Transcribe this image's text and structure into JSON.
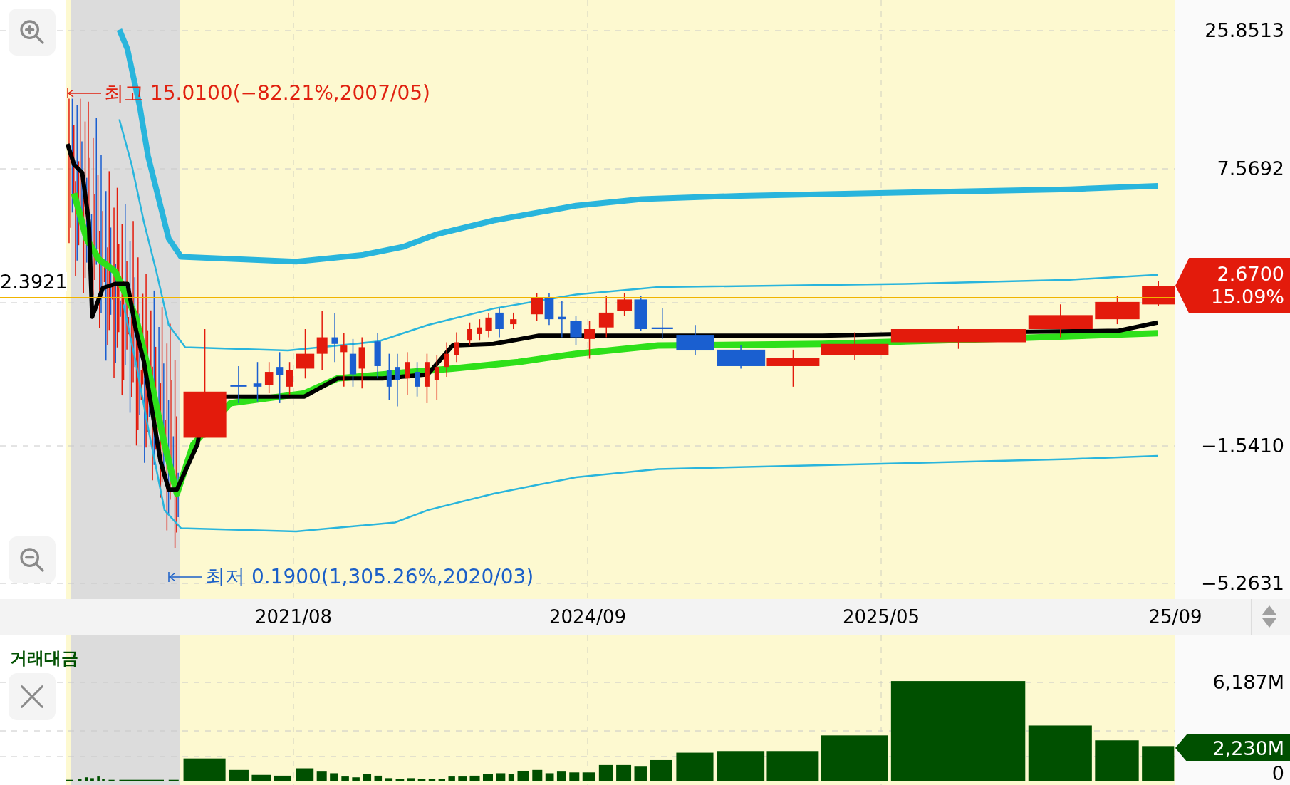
{
  "price_pane": {
    "y_axis_labels": [
      "25.8513",
      "7.5692",
      "−1.5410",
      "−5.2631"
    ],
    "crosshair_label": "2.3921",
    "current_price_tag": {
      "price": "2.6700",
      "change": "15.09%"
    },
    "high_marker": "최고 15.0100(−82.21%,2007/05)",
    "low_marker": "최저 0.1900(1,305.26%,2020/03)"
  },
  "x_axis_labels": [
    "2021/08",
    "2024/09",
    "2025/05",
    "25/09"
  ],
  "volume_pane": {
    "title": "거래대금",
    "y_axis_labels": [
      "6,187M",
      "0"
    ],
    "current_value_tag": "2,230M"
  }
}
